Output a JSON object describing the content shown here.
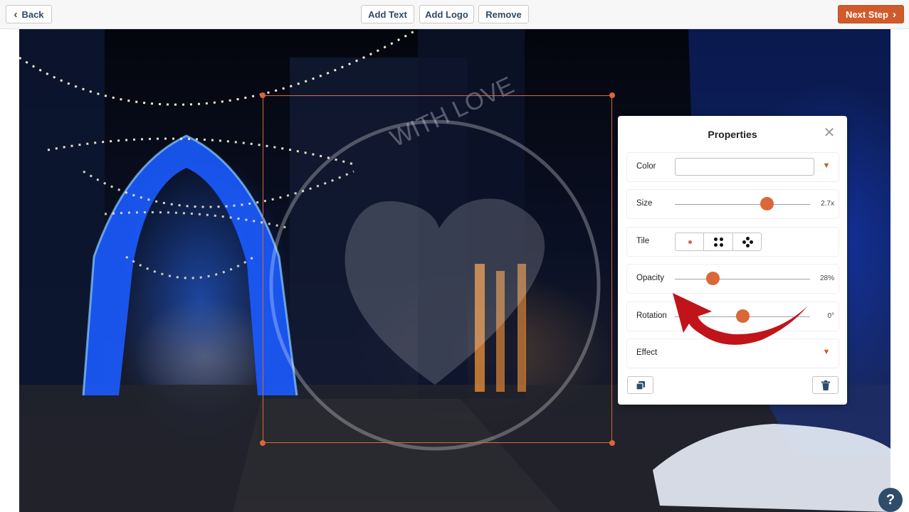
{
  "toolbar": {
    "back_label": "Back",
    "add_text_label": "Add Text",
    "add_logo_label": "Add Logo",
    "remove_label": "Remove",
    "next_step_label": "Next Step"
  },
  "watermark": {
    "text": "WITH LOVE"
  },
  "properties": {
    "title": "Properties",
    "color_label": "Color",
    "color_value": "",
    "size_label": "Size",
    "size_value": "2.7x",
    "size_level": 0.68,
    "tile_label": "Tile",
    "tile_options": [
      "single",
      "grid-4",
      "scatter"
    ],
    "tile_selected": "single",
    "opacity_label": "Opacity",
    "opacity_value": "28%",
    "opacity_level": 0.28,
    "rotation_label": "Rotation",
    "rotation_value": "0°",
    "rotation_level": 0.5,
    "effect_label": "Effect"
  },
  "help": {
    "label": "?"
  },
  "colors": {
    "accent": "#d9673a",
    "button_text": "#2f4a66",
    "next_button_bg": "#d05a2c",
    "help_bg": "#2f4d6b",
    "annotation_arrow": "#c0141a"
  },
  "icons": [
    "chevron-left-icon",
    "chevron-right-icon",
    "close-icon",
    "chevron-down-icon",
    "duplicate-icon",
    "trash-icon",
    "help-icon"
  ]
}
